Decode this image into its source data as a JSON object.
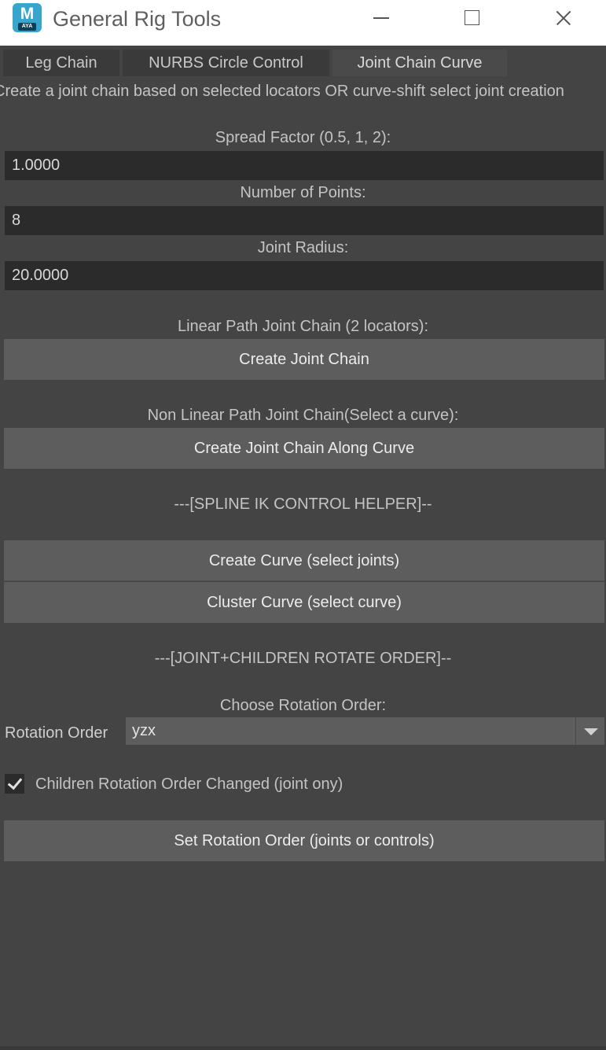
{
  "window": {
    "title": "General Rig Tools",
    "app_icon_letter": "M",
    "app_icon_sub": "AYA"
  },
  "tabs": [
    {
      "label": "Leg Chain",
      "active": false
    },
    {
      "label": "NURBS Circle Control",
      "active": false
    },
    {
      "label": "Joint Chain Curve",
      "active": true
    }
  ],
  "description": "Create a joint chain based on selected locators OR curve-shift select joint creation",
  "fields": {
    "spread_factor": {
      "label": "Spread Factor (0.5, 1, 2):",
      "value": "1.0000"
    },
    "num_points": {
      "label": "Number of Points:",
      "value": "8"
    },
    "joint_radius": {
      "label": "Joint Radius:",
      "value": "20.0000"
    }
  },
  "linear": {
    "label": "Linear Path Joint Chain (2 locators):",
    "button": "Create Joint Chain"
  },
  "nonlinear": {
    "label": "Non Linear Path Joint Chain(Select a curve):",
    "button": "Create Joint Chain Along Curve"
  },
  "spline_ik": {
    "header": "---[SPLINE IK CONTROL HELPER]--",
    "create_curve": "Create Curve (select joints)",
    "cluster_curve": "Cluster Curve (select curve)"
  },
  "rotate_order": {
    "header": "---[JOINT+CHILDREN ROTATE ORDER]--",
    "choose_label": "Choose Rotation Order:",
    "field_label": "Rotation Order",
    "selected": "yzx",
    "children_checkbox_label": "Children Rotation Order Changed (joint ony)",
    "children_checked": true,
    "set_button": "Set Rotation Order (joints or controls)"
  }
}
